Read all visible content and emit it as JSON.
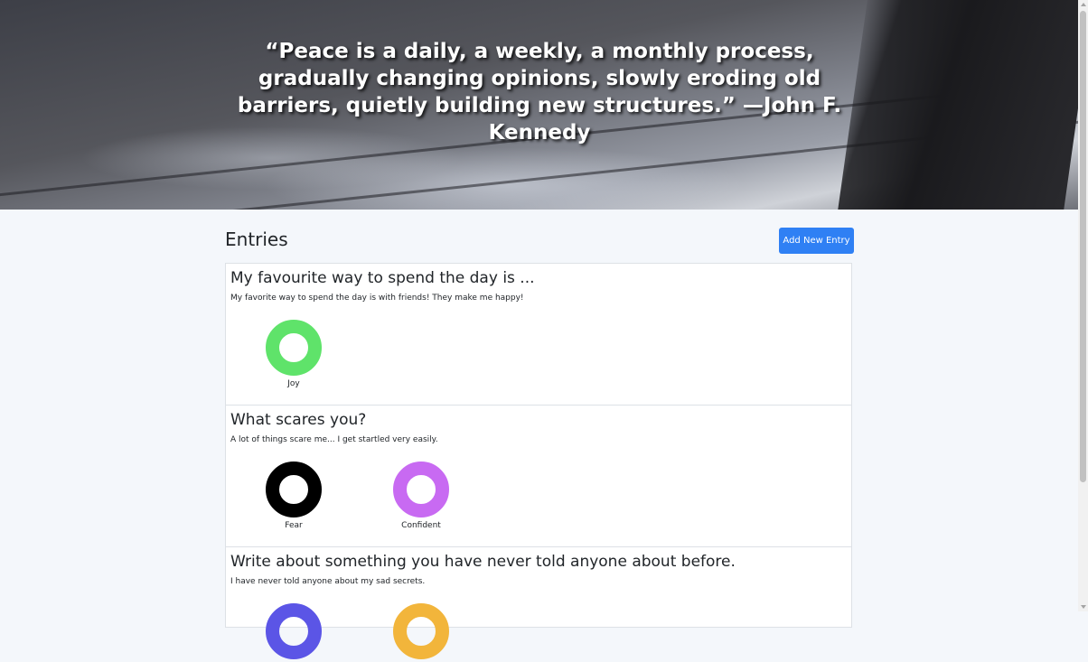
{
  "hero": {
    "quote": "“Peace is a daily, a weekly, a monthly process, gradually changing opinions, slowly eroding old barriers, quietly building new structures.” —John F. Kennedy"
  },
  "entries_section": {
    "heading": "Entries",
    "add_button_label": "Add New Entry"
  },
  "entries": [
    {
      "title": "My favourite way to spend the day is ...",
      "body": "My favorite way to spend the day is with friends! They make me happy!",
      "emotions": [
        {
          "label": "Joy",
          "color": "#5fe36a",
          "icon": "donut-ring"
        }
      ]
    },
    {
      "title": "What scares you?",
      "body": "A lot of things scare me... I get startled very easily.",
      "emotions": [
        {
          "label": "Fear",
          "color": "#000000",
          "icon": "donut-ring"
        },
        {
          "label": "Confident",
          "color": "#c86af2",
          "icon": "donut-ring"
        }
      ]
    },
    {
      "title": "Write about something you have never told anyone about before.",
      "body": "I have never told anyone about my sad secrets.",
      "emotions": [
        {
          "label": "",
          "color": "#5b55e6",
          "icon": "donut-ring"
        },
        {
          "label": "",
          "color": "#f2b53b",
          "icon": "donut-ring"
        }
      ]
    }
  ]
}
